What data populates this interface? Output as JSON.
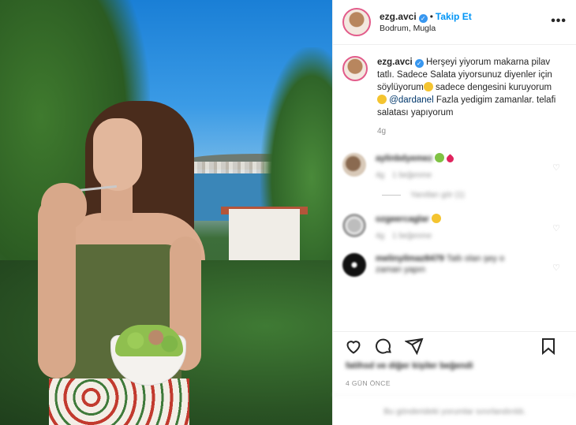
{
  "header": {
    "username": "ezg.avci",
    "verified_badge": "✓",
    "separator": "•",
    "follow_label": "Takip Et",
    "location": "Bodrum, Mugla",
    "more_icon": "more-dots-icon",
    "more_symbol": "•••"
  },
  "caption": {
    "username": "ezg.avci",
    "text_1": "Herşeyi yiyorum makarna pilav tatlı. Sadece Salata yiyorsunuz diyenler için söylüyorum",
    "text_2": "sadece dengesini kuruyorum",
    "mention": "@dardanel",
    "text_3": "Fazla yedigim zamanlar. telafi salatası yapıyorum",
    "time": "4g"
  },
  "comments": [
    {
      "username": "aylinbdyemez",
      "text": "",
      "time": "4g",
      "likes": "1 beğenme"
    },
    {
      "username": "ozgeercaglar",
      "text": "",
      "time": "4g",
      "likes": "1 beğenme"
    },
    {
      "username": "melinyilmaz8479",
      "text": "Tatlı olan şey o",
      "text2": "zaman yapın"
    }
  ],
  "replies_label": "Yanıtları gör (1)",
  "likes_text": "fatihsd ve diğer kişiler beğendi",
  "post_time": "4 GÜN ÖNCE",
  "add_comment_placeholder": "Bu gönderideki yorumlar sınırlandırıldı.",
  "colors": {
    "accent": "#0095f6",
    "verified": "#3897f0",
    "mention": "#00376b",
    "muted": "#8e8e8e"
  }
}
